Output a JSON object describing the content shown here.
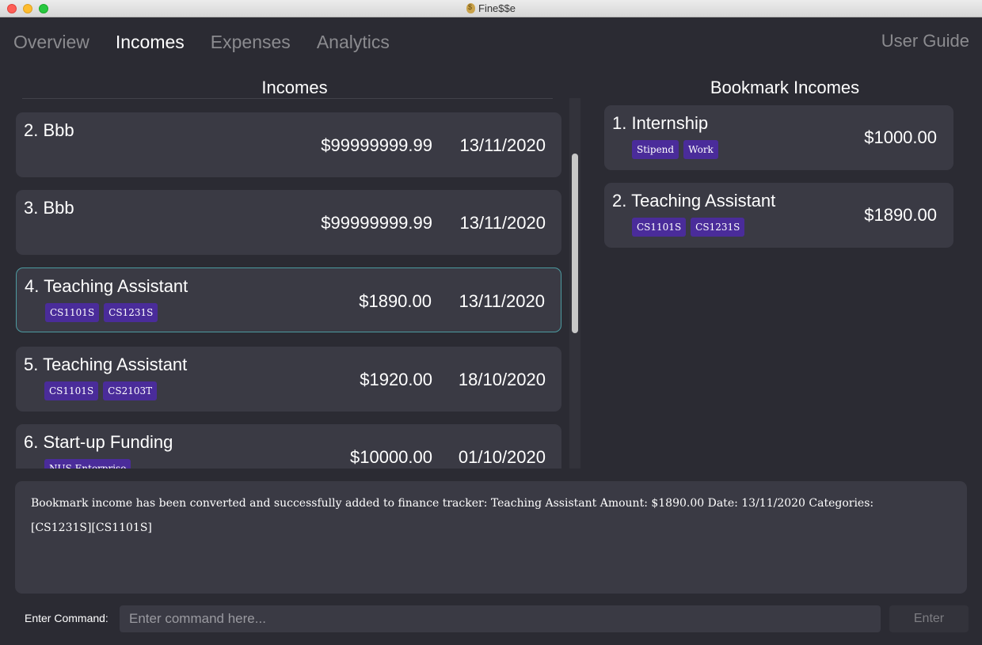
{
  "window": {
    "title": "Fine$$e"
  },
  "tabs": [
    {
      "label": "Overview"
    },
    {
      "label": "Incomes"
    },
    {
      "label": "Expenses"
    },
    {
      "label": "Analytics"
    }
  ],
  "user_guide_label": "User Guide",
  "incomes": {
    "title": "Incomes",
    "items": [
      {
        "name": "2. Bbb",
        "amount": "$99999999.99",
        "date": "13/11/2020",
        "tags": []
      },
      {
        "name": "3. Bbb",
        "amount": "$99999999.99",
        "date": "13/11/2020",
        "tags": []
      },
      {
        "name": "4. Teaching Assistant",
        "amount": "$1890.00",
        "date": "13/11/2020",
        "tags": [
          "CS1101S",
          "CS1231S"
        ]
      },
      {
        "name": "5. Teaching Assistant",
        "amount": "$1920.00",
        "date": "18/10/2020",
        "tags": [
          "CS1101S",
          "CS2103T"
        ]
      },
      {
        "name": "6. Start-up Funding",
        "amount": "$10000.00",
        "date": "01/10/2020",
        "tags": [
          "NUS Enterprise"
        ]
      }
    ]
  },
  "bookmarks": {
    "title": "Bookmark Incomes",
    "items": [
      {
        "name": "1. Internship",
        "amount": "$1000.00",
        "tags": [
          "Stipend",
          "Work"
        ]
      },
      {
        "name": "2. Teaching Assistant",
        "amount": "$1890.00",
        "tags": [
          "CS1101S",
          "CS1231S"
        ]
      }
    ]
  },
  "result": {
    "line1": "Bookmark income has been converted and successfully added to finance tracker: Teaching Assistant Amount: $1890.00 Date: 13/11/2020 Categories:",
    "line2": "[CS1231S][CS1101S]"
  },
  "command": {
    "label": "Enter Command:",
    "placeholder": "Enter command here...",
    "value": "",
    "enter_label": "Enter"
  },
  "colors": {
    "background": "#2b2b33",
    "card": "#3a3a44",
    "tag": "#4a2c9a",
    "selected_border": "#4c9aa0",
    "inactive_tab": "#8b8b8f"
  }
}
